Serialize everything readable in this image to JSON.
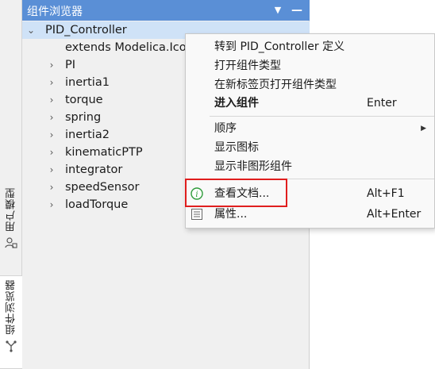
{
  "side_tabs": {
    "user_models": "用户模型",
    "component_browser": "组件浏览器"
  },
  "panel": {
    "title": "组件浏览器",
    "menu_icon": "dropdown-triangle-icon",
    "minimize_icon": "minimize-icon"
  },
  "tree": {
    "root": "PID_Controller",
    "items": [
      {
        "label": "extends Modelica.Ico",
        "expandable": false
      },
      {
        "label": "PI",
        "expandable": true
      },
      {
        "label": "inertia1",
        "expandable": true
      },
      {
        "label": "torque",
        "expandable": true
      },
      {
        "label": "spring",
        "expandable": true
      },
      {
        "label": "inertia2",
        "expandable": true
      },
      {
        "label": "kinematicPTP",
        "expandable": true
      },
      {
        "label": "integrator",
        "expandable": true
      },
      {
        "label": "speedSensor",
        "expandable": true
      },
      {
        "label": "loadTorque",
        "expandable": true
      }
    ]
  },
  "context_menu": {
    "goto_def": "转到 PID_Controller 定义",
    "open_type": "打开组件类型",
    "open_type_new_tab": "在新标签页打开组件类型",
    "enter": {
      "label": "进入组件",
      "shortcut": "Enter"
    },
    "order": "顺序",
    "show_icon": "显示图标",
    "show_nongraphic": "显示非图形组件",
    "view_doc": {
      "label": "查看文档...",
      "shortcut": "Alt+F1",
      "icon": "info-icon"
    },
    "properties": {
      "label": "属性...",
      "shortcut": "Alt+Enter",
      "icon": "properties-list-icon"
    }
  },
  "colors": {
    "titlebar": "#5a8fd6",
    "selection": "#cfe2f7",
    "highlight_box": "#e01e1e",
    "info_icon": "#2e9b3a"
  }
}
